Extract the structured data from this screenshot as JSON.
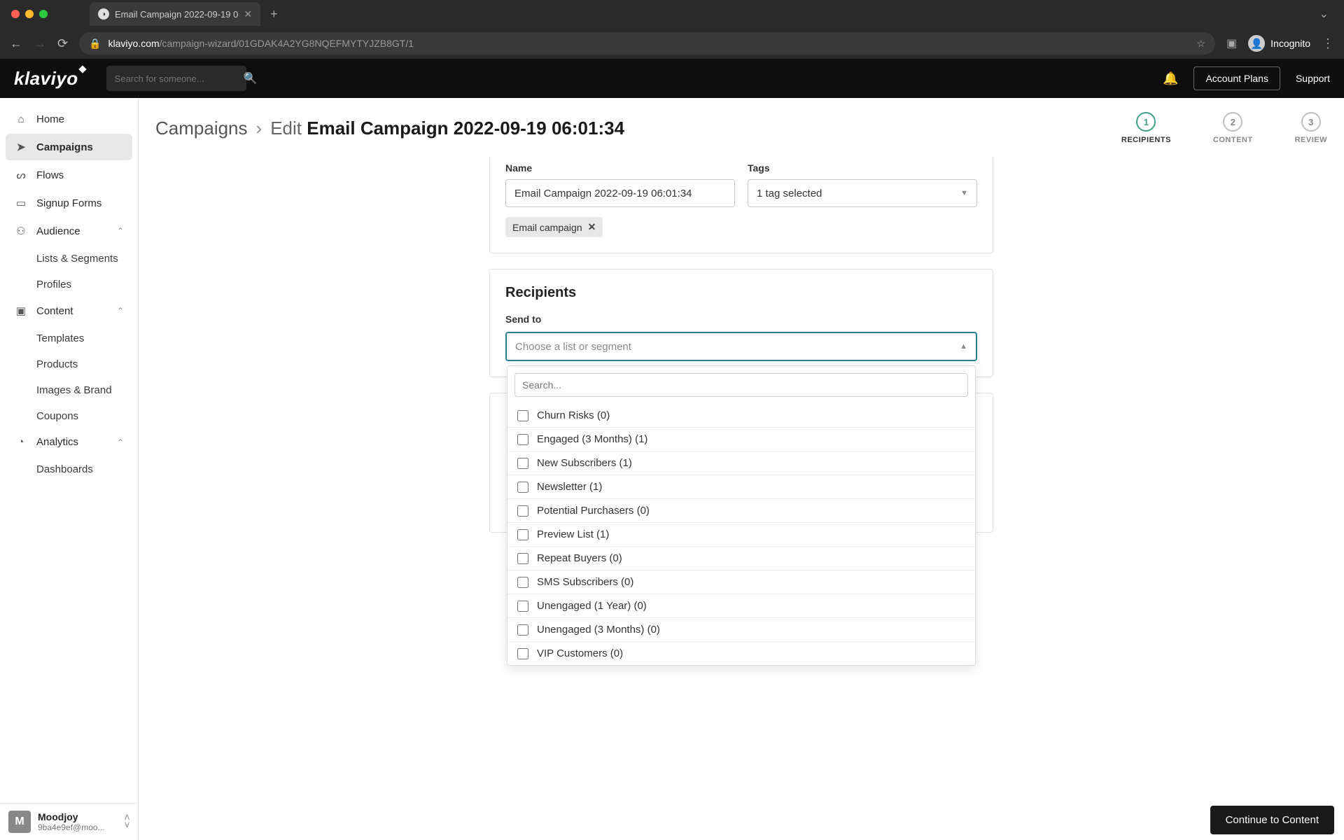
{
  "browser": {
    "tab_title": "Email Campaign 2022-09-19 0",
    "url_domain": "klaviyo.com",
    "url_path": "/campaign-wizard/01GDAK4A2YG8NQEFMYTYJZB8GT/1",
    "incognito_label": "Incognito"
  },
  "header": {
    "logo": "klaviyo",
    "search_placeholder": "Search for someone...",
    "account_plans": "Account Plans",
    "support": "Support"
  },
  "sidebar": {
    "items": [
      {
        "label": "Home",
        "icon": "⌂"
      },
      {
        "label": "Campaigns",
        "icon": "➤",
        "active": true
      },
      {
        "label": "Flows",
        "icon": "∞"
      },
      {
        "label": "Signup Forms",
        "icon": "▭"
      },
      {
        "label": "Audience",
        "icon": "⚇",
        "expandable": true,
        "sub": [
          "Lists & Segments",
          "Profiles"
        ]
      },
      {
        "label": "Content",
        "icon": "▣",
        "expandable": true,
        "sub": [
          "Templates",
          "Products",
          "Images & Brand",
          "Coupons"
        ]
      },
      {
        "label": "Analytics",
        "icon": "◔",
        "expandable": true,
        "sub": [
          "Dashboards"
        ]
      }
    ],
    "user": {
      "initial": "M",
      "name": "Moodjoy",
      "email": "9ba4e9ef@moo..."
    }
  },
  "breadcrumb": {
    "root": "Campaigns",
    "action": "Edit",
    "title": "Email Campaign 2022-09-19 06:01:34"
  },
  "stepper": [
    {
      "num": "1",
      "label": "RECIPIENTS",
      "active": true
    },
    {
      "num": "2",
      "label": "CONTENT"
    },
    {
      "num": "3",
      "label": "REVIEW"
    }
  ],
  "form": {
    "name_label": "Name",
    "name_value": "Email Campaign 2022-09-19 06:01:34",
    "tags_label": "Tags",
    "tags_value": "1 tag selected",
    "tag_chip": "Email campaign",
    "recipients_title": "Recipients",
    "send_to_label": "Send to",
    "combo_placeholder": "Choose a list or segment",
    "dropdown_search_placeholder": "Search...",
    "options": [
      "Churn Risks (0)",
      "Engaged (3 Months) (1)",
      "New Subscribers (1)",
      "Newsletter (1)",
      "Potential Purchasers (0)",
      "Preview List (1)",
      "Repeat Buyers (0)",
      "SMS Subscribers (0)",
      "Unengaged (1 Year) (0)",
      "Unengaged (3 Months) (0)",
      "VIP Customers (0)"
    ]
  },
  "footer": {
    "continue": "Continue to Content"
  }
}
